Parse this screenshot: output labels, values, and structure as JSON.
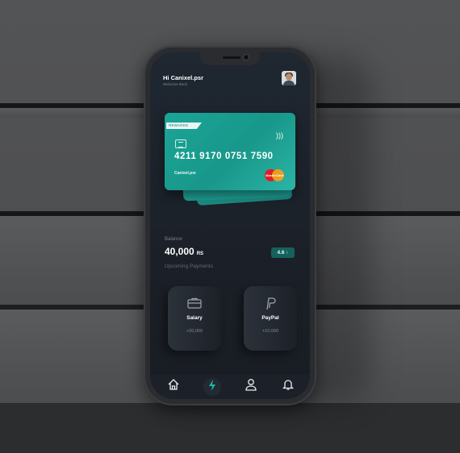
{
  "header": {
    "greeting": "Hi Canixel.psr",
    "subtitle": "Welcome Back",
    "avatar_icon": "user-avatar"
  },
  "card": {
    "badge": "REWARDS",
    "number": "4211  9170  0751  7590",
    "holder": "Canixel.psr",
    "brand": "MasterCard",
    "contactless_icon": "contactless-icon",
    "chip_icon": "chip-icon",
    "accent": "#1aa597"
  },
  "balance": {
    "label": "Balance",
    "amount": "40,000",
    "currency": "RS",
    "change": "4.6",
    "change_icon": "arrow-up-icon"
  },
  "upcoming": {
    "title": "Upcoming Payments",
    "items": [
      {
        "icon": "briefcase-icon",
        "label": "Salary",
        "amount": "+20,000"
      },
      {
        "icon": "paypal-icon",
        "label": "PayPal",
        "amount": "+10,000"
      }
    ]
  },
  "nav": {
    "items": [
      "home-icon",
      "lightning-icon",
      "user-icon",
      "bell-icon"
    ],
    "active": "lightning-icon",
    "active_color": "#18b8a6"
  }
}
